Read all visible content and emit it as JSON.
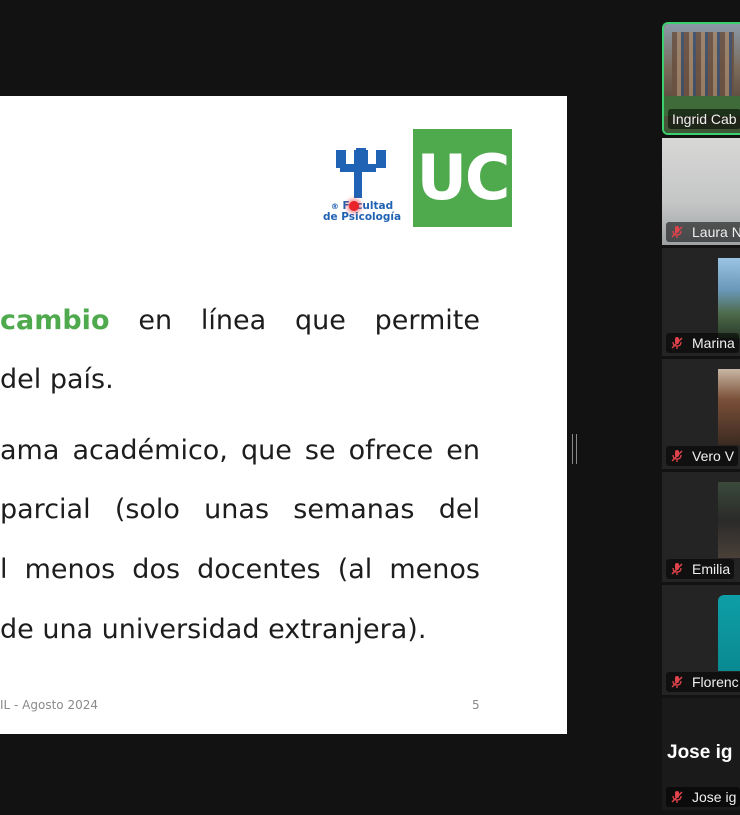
{
  "slide": {
    "line1": {
      "highlight": "cambio",
      "rest": "en línea que permite"
    },
    "line2": "del país.",
    "line3": "ama académico, que se ofrece en",
    "line4": "parcial (solo unas semanas del",
    "line5": "l menos dos docentes (al menos",
    "line6": "de una universidad extranjera).",
    "footer_left": "IL - Agosto 2024",
    "page_number": "5",
    "logo_uc_text": "UC",
    "logo_psico_line1": "Facultad",
    "logo_psico_line2": "de Psicología",
    "logo_psico_mark": "®"
  },
  "participants": [
    {
      "name": "Ingrid Cab",
      "active": true,
      "muted": false
    },
    {
      "name": "Laura N",
      "muted": true
    },
    {
      "name": "Marina",
      "muted": true
    },
    {
      "name": "Vero V",
      "muted": true
    },
    {
      "name": "Emilia",
      "muted": true
    },
    {
      "name": "Florenc",
      "muted": true
    },
    {
      "name": "Jose ig",
      "display_name": "Jose ig",
      "muted": true
    }
  ],
  "colors": {
    "background": "#121212",
    "tile": "#242424",
    "active_border": "#3bd16f",
    "accent_green": "#4fa94d",
    "muted_icon": "#e0434b",
    "psico_blue": "#2062b3"
  }
}
